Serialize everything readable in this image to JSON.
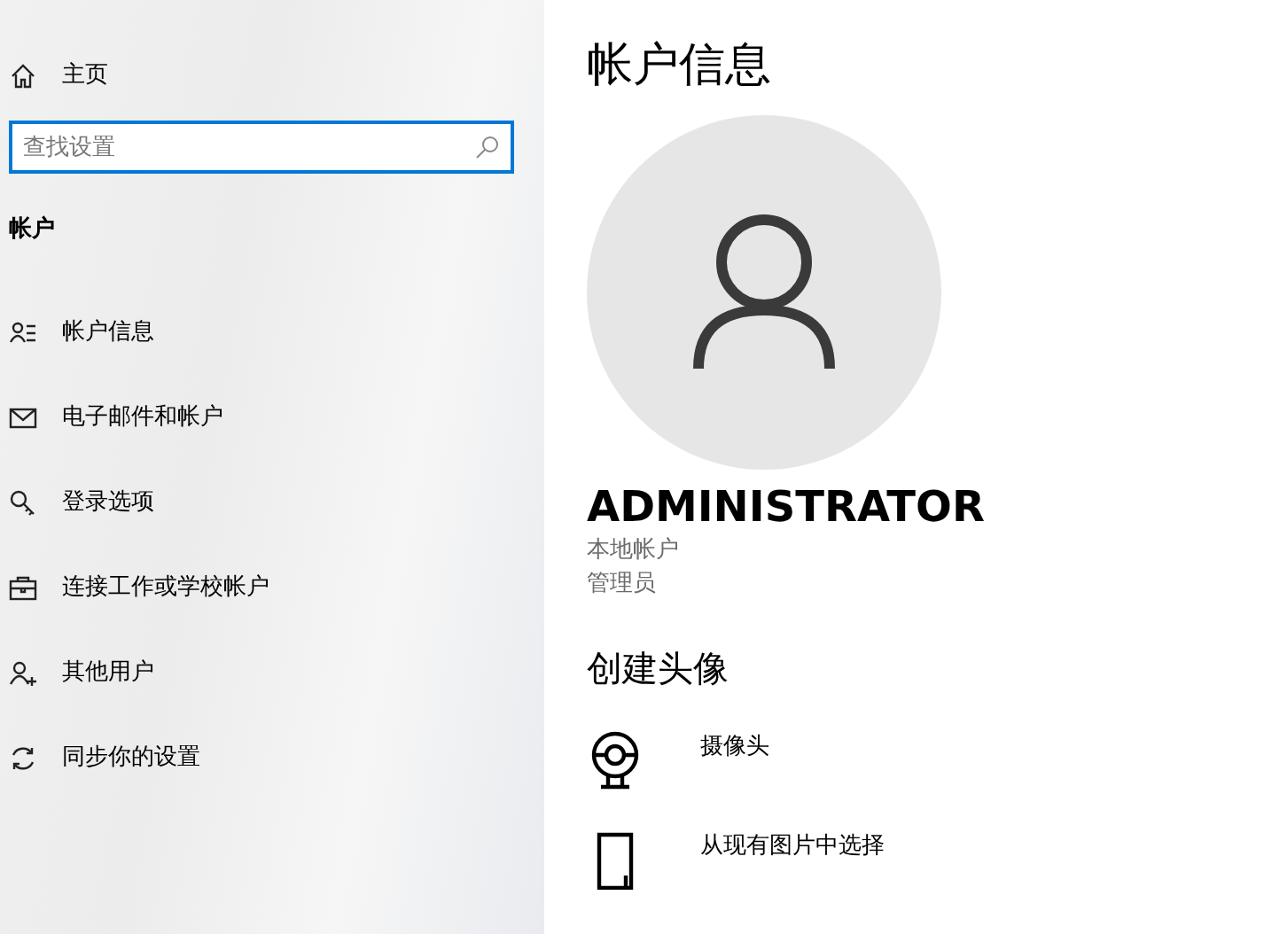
{
  "sidebar": {
    "home": "主页",
    "search": {
      "placeholder": "查找设置"
    },
    "section_title": "帐户",
    "items": [
      {
        "label": "帐户信息"
      },
      {
        "label": "电子邮件和帐户"
      },
      {
        "label": "登录选项"
      },
      {
        "label": "连接工作或学校帐户"
      },
      {
        "label": "其他用户"
      },
      {
        "label": "同步你的设置"
      }
    ]
  },
  "main": {
    "title": "帐户信息",
    "user_name": "ADMINISTRATOR",
    "details": [
      "本地帐户",
      "管理员"
    ],
    "create_title": "创建头像",
    "options": [
      {
        "label": "摄像头"
      },
      {
        "label": "从现有图片中选择"
      }
    ]
  }
}
